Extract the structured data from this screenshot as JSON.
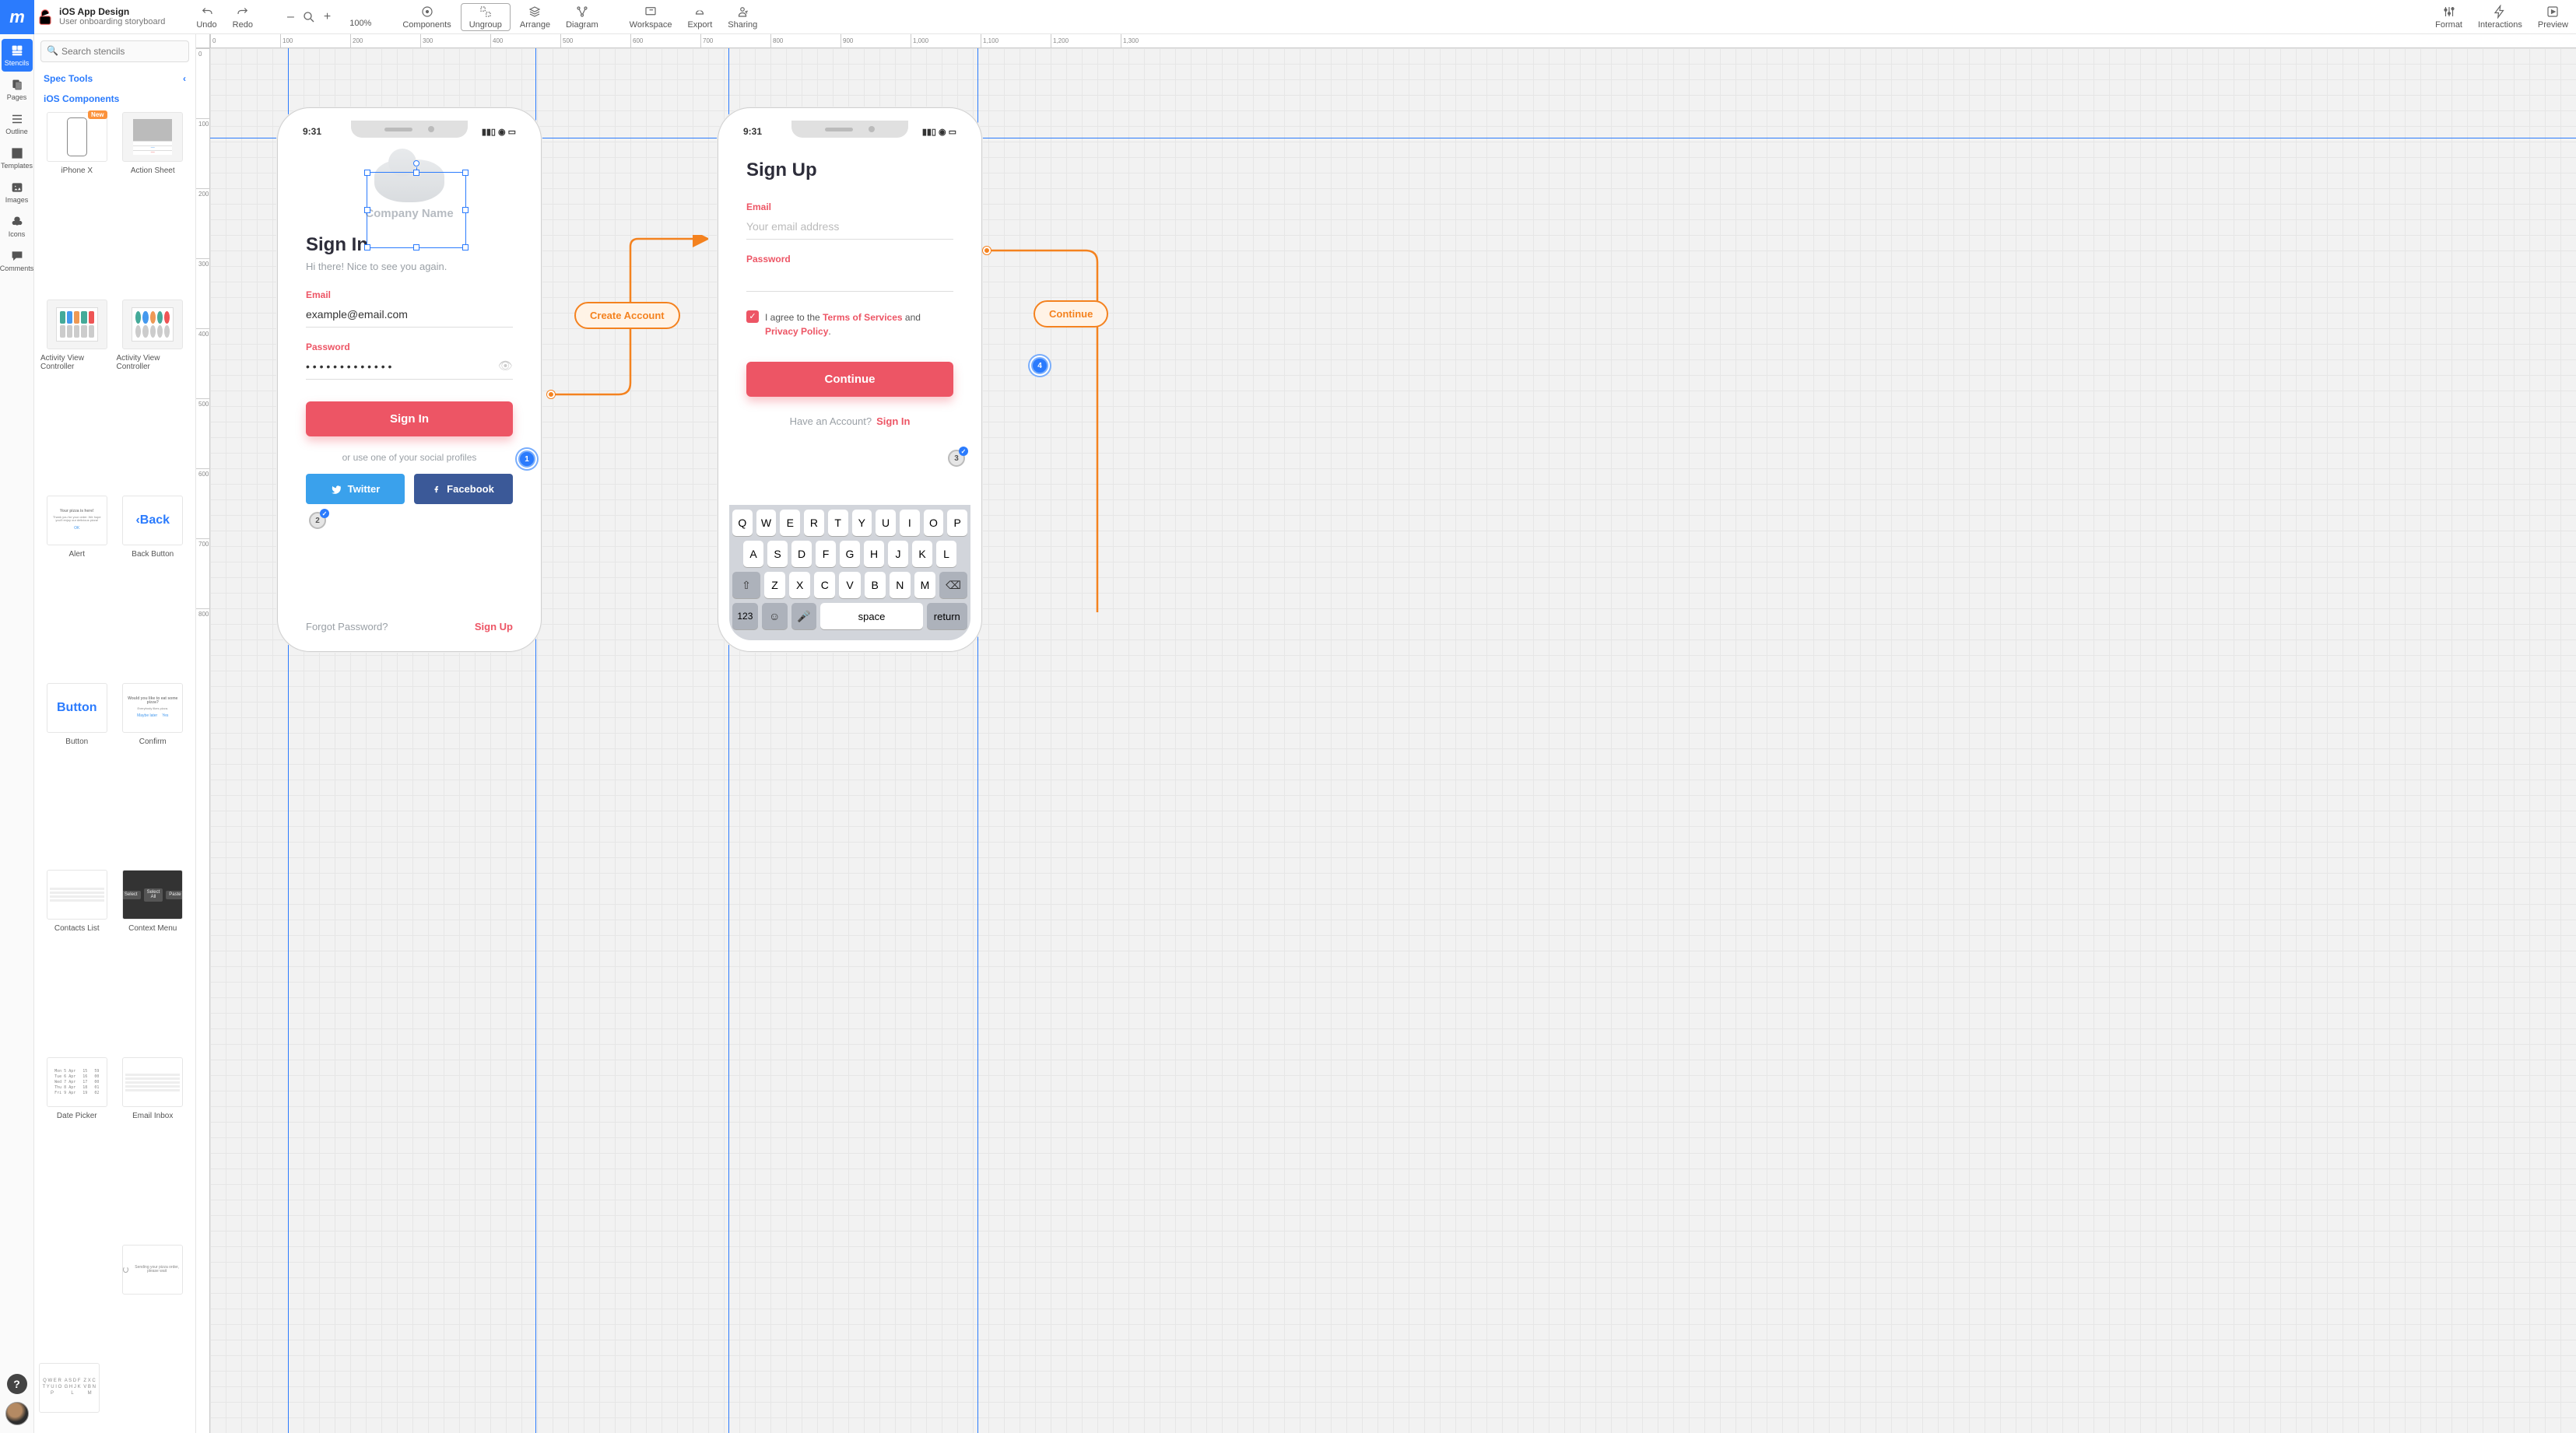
{
  "doc": {
    "title": "iOS App Design",
    "subtitle": "User onboarding storyboard"
  },
  "toolbar": {
    "undo": "Undo",
    "redo": "Redo",
    "zoom_minus": "–",
    "zoom_plus": "+",
    "zoom": "100%",
    "components": "Components",
    "ungroup": "Ungroup",
    "arrange": "Arrange",
    "diagram": "Diagram",
    "workspace": "Workspace",
    "export": "Export",
    "sharing": "Sharing",
    "format": "Format",
    "interactions": "Interactions",
    "preview": "Preview"
  },
  "rail": {
    "stencils": "Stencils",
    "pages": "Pages",
    "outline": "Outline",
    "templates": "Templates",
    "images": "Images",
    "icons": "Icons",
    "comments": "Comments"
  },
  "panel": {
    "search_placeholder": "Search stencils",
    "cat_spec": "Spec Tools",
    "cat_ios": "iOS Components",
    "items": [
      "iPhone X",
      "Action Sheet",
      "Activity View Controller",
      "Activity View Controller",
      "Alert",
      "Back Button",
      "Button",
      "Confirm",
      "Contacts List",
      "Context Menu",
      "Date Picker",
      "Email Inbox"
    ],
    "badge_new": "New",
    "back_label": "Back",
    "button_label": "Button",
    "alert_title": "Your pizza is here!",
    "alert_body": "Thank you for your order. We hope you'll enjoy our delicious pizza!",
    "alert_ok": "OK",
    "confirm_title": "Would you like to eat some pizza?",
    "confirm_sub": "Everybody likes pizza.",
    "confirm_later": "Maybe later",
    "confirm_yes": "Yes",
    "ctx_select": "Select",
    "ctx_selectall": "Select All",
    "ctx_paste": "Paste",
    "toast": "Sending your pizza order, please wait",
    "kbd_r1": "Q W E R T Y U I O P",
    "kbd_r2": "A S D F G H J K L",
    "kbd_r3": "Z X C V B N M",
    "date_rows": "Mon 5 Apr   15   59\nTue 6 Apr   16   00\nWed 7 Apr   17   00\nThu 8 Apr   18   01\nFri 9 Apr   19   02"
  },
  "ruler_h": [
    "0",
    "100",
    "200",
    "300",
    "400",
    "500",
    "600",
    "700",
    "800",
    "900",
    "1,000",
    "1,100",
    "1,200",
    "1,300"
  ],
  "ruler_v": [
    "0",
    "100",
    "200",
    "300",
    "400",
    "500",
    "600",
    "700",
    "800"
  ],
  "signin": {
    "time": "9:31",
    "company": "Company Name",
    "title": "Sign In",
    "sub": "Hi there! Nice to see you again.",
    "email_label": "Email",
    "email_value": "example@email.com",
    "password_label": "Password",
    "password_value": "• • • • • • • • • • • • •",
    "signin_btn": "Sign In",
    "or": "or use one of your social profiles",
    "twitter": "Twitter",
    "facebook": "Facebook",
    "forgot": "Forgot Password?",
    "signup": "Sign Up"
  },
  "signup": {
    "time": "9:31",
    "title": "Sign Up",
    "email_label": "Email",
    "email_placeholder": "Your email address",
    "password_label": "Password",
    "agree_pre": "I agree to the ",
    "tos": "Terms of Services",
    "agree_mid": " and ",
    "pp": "Privacy Policy",
    "agree_post": ".",
    "continue_btn": "Continue",
    "have": "Have an Account?",
    "signin": "Sign In"
  },
  "keyboard": {
    "r1": [
      "Q",
      "W",
      "E",
      "R",
      "T",
      "Y",
      "U",
      "I",
      "O",
      "P"
    ],
    "r2": [
      "A",
      "S",
      "D",
      "F",
      "G",
      "H",
      "J",
      "K",
      "L"
    ],
    "r3": [
      "Z",
      "X",
      "C",
      "V",
      "B",
      "N",
      "M"
    ],
    "num": "123",
    "space": "space",
    "return": "return"
  },
  "pills": {
    "create": "Create Account",
    "continue": "Continue"
  },
  "badges": {
    "b1": "1",
    "b2": "2",
    "b3": "3",
    "b4": "4"
  }
}
